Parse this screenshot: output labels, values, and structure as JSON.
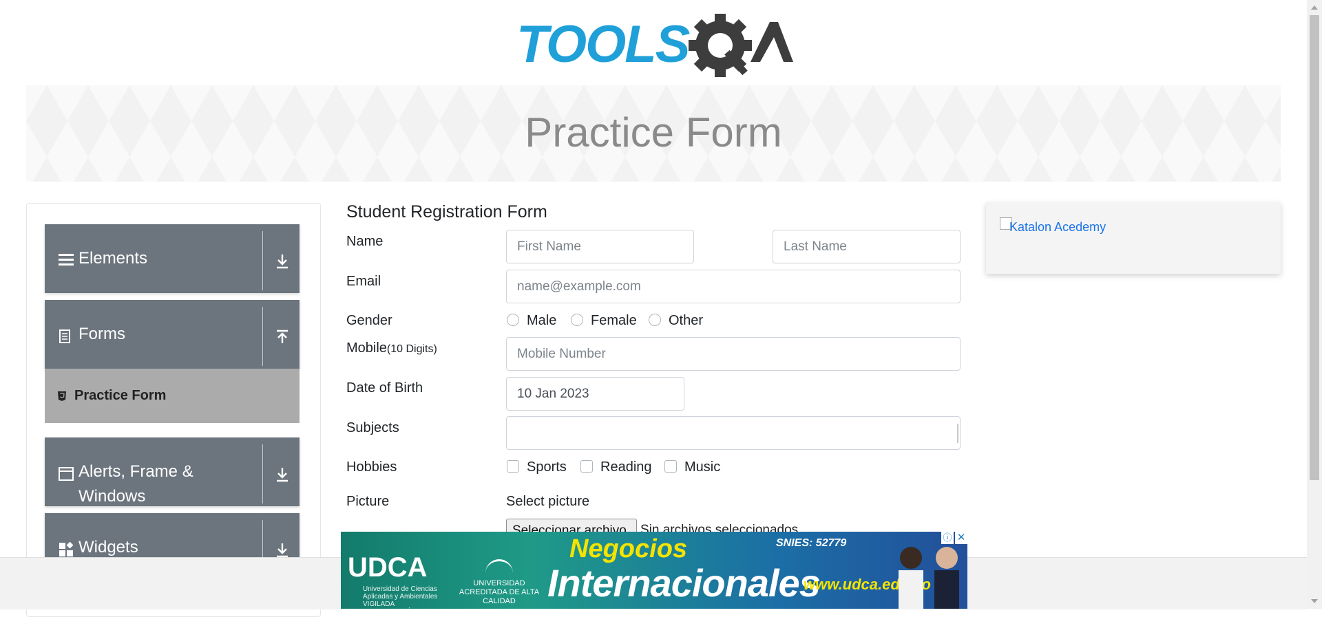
{
  "header": {
    "logo_text_left": "TOOLS",
    "logo_text_right": "QA",
    "logo_color_blue": "#1fa0d8",
    "logo_color_dark": "#3d3d3d"
  },
  "banner": {
    "title": "Practice Form"
  },
  "sidebar": {
    "groups": [
      {
        "label": "Elements",
        "icon": "hamburger-icon",
        "arrow": "download-arrow-icon"
      },
      {
        "label": "Forms",
        "icon": "document-icon",
        "arrow": "upload-arrow-icon"
      },
      {
        "label_line1": "Alerts, Frame &",
        "label_line2": "Windows",
        "icon": "window-icon",
        "arrow": "download-arrow-icon"
      },
      {
        "label": "Widgets",
        "icon": "widgets-icon",
        "arrow": "download-arrow-icon"
      }
    ],
    "active_item": {
      "label": "Practice Form",
      "icon": "html5-icon"
    },
    "colors": {
      "group_bg": "#6c757d",
      "active_bg": "#ababab"
    }
  },
  "form": {
    "title": "Student Registration Form",
    "name_label": "Name",
    "first_name_placeholder": "First Name",
    "last_name_placeholder": "Last Name",
    "email_label": "Email",
    "email_placeholder": "name@example.com",
    "gender_label": "Gender",
    "gender_options": [
      "Male",
      "Female",
      "Other"
    ],
    "mobile_label": "Mobile",
    "mobile_hint": "(10 Digits)",
    "mobile_placeholder": "Mobile Number",
    "dob_label": "Date of Birth",
    "dob_value": "10 Jan 2023",
    "subjects_label": "Subjects",
    "subjects_value": "",
    "hobbies_label": "Hobbies",
    "hobbies_options": [
      "Sports",
      "Reading",
      "Music"
    ],
    "picture_label": "Picture",
    "picture_select_label": "Select picture",
    "file_button": "Seleccionar archivo",
    "file_status": "Sin archivos seleccionados"
  },
  "right_ad": {
    "alt_text": "Katalon Acedemy"
  },
  "bottom_ad": {
    "brand": "UDCA",
    "brand_sub": "Universidad de Ciencias Aplicadas y Ambientales",
    "brand_tag": "VIGILADA MINEDUCACIÓN",
    "accreditation": "UNIVERSIDAD ACREDITADA DE ALTA CALIDAD",
    "headline_top": "Negocios",
    "headline_bottom": "Internacionales",
    "snies": "SNIES: 52779",
    "url": "www.udca.edu.co",
    "adchoices_icon": "info-icon",
    "close_icon": "close-icon"
  }
}
